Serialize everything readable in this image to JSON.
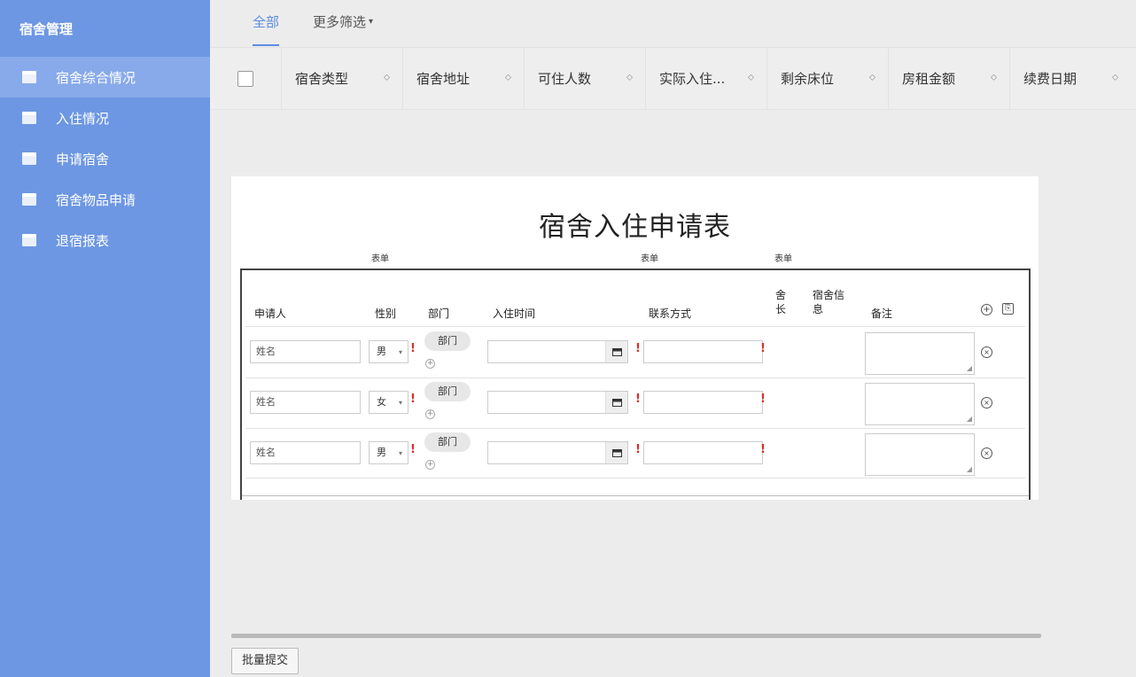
{
  "sidebar": {
    "title": "宿舍管理",
    "items": [
      {
        "label": "宿舍综合情况",
        "active": true,
        "icon": "folder-icon"
      },
      {
        "label": "入住情况",
        "active": false,
        "icon": "folder-icon"
      },
      {
        "label": "申请宿舍",
        "active": false,
        "icon": "folder-icon"
      },
      {
        "label": "宿舍物品申请",
        "active": false,
        "icon": "folder-icon"
      },
      {
        "label": "退宿报表",
        "active": false,
        "icon": "folder-icon"
      }
    ]
  },
  "tabs": {
    "all": "全部",
    "more_filter": "更多筛选",
    "caret": "▾"
  },
  "table": {
    "columns": [
      "宿舍类型",
      "宿舍地址",
      "可住人数",
      "实际入住...",
      "剩余床位",
      "房租金额",
      "续费日期"
    ],
    "sort_icon": "⬦"
  },
  "form": {
    "title": "宿舍入住申请表",
    "meta_left": "表单",
    "meta_mid": "表单",
    "meta_right": "表单",
    "headers": {
      "applicant": "申请人",
      "gender": "性别",
      "department": "部门",
      "checkin_time": "入住时间",
      "contact": "联系方式",
      "dorm_head_1": "舍",
      "dorm_head_2": "长",
      "dorm_info_1": "宿舍信",
      "dorm_info_2": "息",
      "remark": "备注"
    },
    "rows": [
      {
        "name": "姓名",
        "gender": "男",
        "dept": "部门",
        "required": "!"
      },
      {
        "name": "姓名",
        "gender": "女",
        "dept": "部门",
        "required": "!"
      },
      {
        "name": "姓名",
        "gender": "男",
        "dept": "部门",
        "required": "!"
      }
    ],
    "add_symbol": "+",
    "copy_symbol": "⎘",
    "del_symbol": "×",
    "grip_symbol": "◢"
  },
  "footer": {
    "batch_button": "批量提交"
  },
  "colors": {
    "sidebar_bg": "#6d97e3",
    "active_tab": "#5b8de0",
    "required": "#d9302b"
  }
}
